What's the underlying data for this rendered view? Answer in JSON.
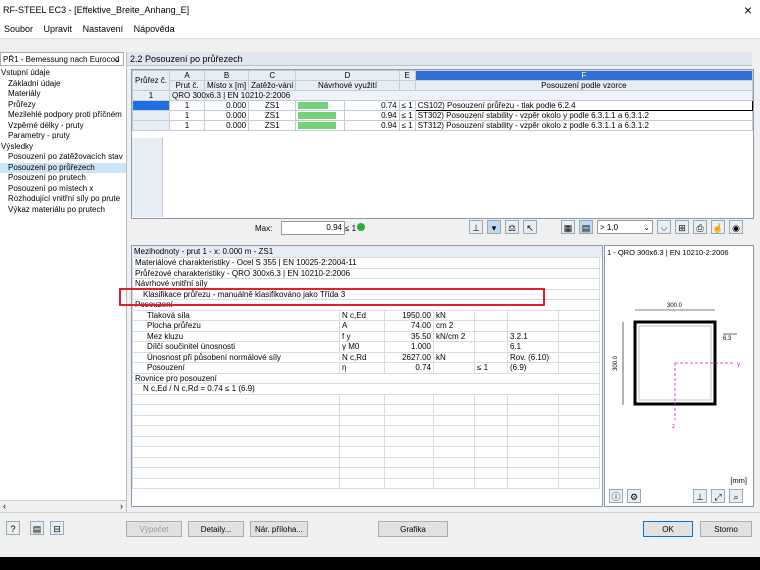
{
  "window": {
    "title": "RF-STEEL EC3 - [Effektive_Breite_Anhang_E]",
    "close": "×"
  },
  "menu": [
    "Soubor",
    "Upravit",
    "Nastavení",
    "Nápověda"
  ],
  "case_select": "PŘ1 - Bemessung nach Eurocod",
  "tree": [
    {
      "label": "Vstupní údaje",
      "indent": 0
    },
    {
      "label": "Základní údaje",
      "indent": 1
    },
    {
      "label": "Materiály",
      "indent": 1
    },
    {
      "label": "Průřezy",
      "indent": 1
    },
    {
      "label": "Mezilehlé podpory proti příčném",
      "indent": 1
    },
    {
      "label": "Vzpěrné délky - pruty",
      "indent": 1
    },
    {
      "label": "Parametry - pruty",
      "indent": 1
    },
    {
      "label": "Výsledky",
      "indent": 0
    },
    {
      "label": "Posouzení po zatěžovacích stav",
      "indent": 1
    },
    {
      "label": "Posouzení po průřezech",
      "indent": 1,
      "selected": true
    },
    {
      "label": "Posouzení po prutech",
      "indent": 1
    },
    {
      "label": "Posouzení po místech x",
      "indent": 1
    },
    {
      "label": "Rozhodující vnitřní síly po prute",
      "indent": 1
    },
    {
      "label": "Výkaz materiálu po prutech",
      "indent": 1
    }
  ],
  "panel_title": "2.2 Posouzení po průřezech",
  "grid": {
    "col_letters": [
      "A",
      "B",
      "C",
      "D",
      "E",
      "F"
    ],
    "headers": {
      "prurez": "Průřez č.",
      "prut": "Prut č.",
      "misto": "Místo x [m]",
      "zatez": "Zatěžo-vání",
      "navrh": "Návrhové využití",
      "vzorec": "Posouzení podle vzorce"
    },
    "section_row": {
      "no": "1",
      "label": "QRO 300x6.3 | EN 10210-2:2006"
    },
    "rows": [
      {
        "prut": "1",
        "x": "0.000",
        "lc": "ZS1",
        "util": "0.74",
        "le": "≤ 1",
        "formula": "CS102) Posouzení průřezu - tlak podle 6.2.4"
      },
      {
        "prut": "1",
        "x": "0.000",
        "lc": "ZS1",
        "util": "0.94",
        "le": "≤ 1",
        "formula": "ST302) Posouzení stability - vzpěr okolo y podle 6.3.1.1 a 6.3.1.2"
      },
      {
        "prut": "1",
        "x": "0.000",
        "lc": "ZS1",
        "util": "0.94",
        "le": "≤ 1",
        "formula": "ST312) Posouzení stability - vzpěr okolo z podle 6.3.1.1 a 6.3.1.2"
      }
    ],
    "util_fractions": [
      0.74,
      0.94,
      0.94
    ],
    "max_label": "Max:",
    "max_value": "0.94",
    "max_le": "≤ 1",
    "filter_value": "> 1,0"
  },
  "detail": {
    "header": "Mezihodnoty - prut 1 - x: 0.000 m - ZS1",
    "rows": [
      {
        "kind": "group",
        "label": "Materiálové charakteristiky - Ocel S 355 | EN 10025-2:2004-11"
      },
      {
        "kind": "group",
        "label": "Průřezové charakteristiky - QRO 300x6.3 | EN 10210-2:2006"
      },
      {
        "kind": "group",
        "label": "Návrhové vnitřní síly"
      },
      {
        "kind": "plain",
        "label": "Klasifikace průřezu - manuálně klasifikováno jako Třída 3"
      },
      {
        "kind": "group",
        "label": "Posouzení"
      },
      {
        "kind": "val",
        "label": "Tlaková síla",
        "sym": "N c,Ed",
        "val": "1950.00",
        "unit": "kN",
        "le": "",
        "ref": ""
      },
      {
        "kind": "val",
        "label": "Plocha průřezu",
        "sym": "A",
        "val": "74.00",
        "unit": "cm 2",
        "le": "",
        "ref": ""
      },
      {
        "kind": "val",
        "label": "Mez kluzu",
        "sym": "f y",
        "val": "35.50",
        "unit": "kN/cm 2",
        "le": "",
        "ref": "3.2.1"
      },
      {
        "kind": "val",
        "label": "Dílčí součinitel únosnosti",
        "sym": "γ M0",
        "val": "1.000",
        "unit": "",
        "le": "",
        "ref": "6.1"
      },
      {
        "kind": "val",
        "label": "Únosnost při působení normálové síly",
        "sym": "N c,Rd",
        "val": "2627.00",
        "unit": "kN",
        "le": "",
        "ref": "Rov. (6.10)"
      },
      {
        "kind": "val",
        "label": "Posouzení",
        "sym": "η",
        "val": "0.74",
        "unit": "",
        "le": "≤ 1",
        "ref": "(6.9)"
      },
      {
        "kind": "group",
        "label": "Rovnice pro posouzení"
      },
      {
        "kind": "plain",
        "label": "N c,Ed / N c,Rd = 0.74 ≤ 1   (6.9)"
      }
    ]
  },
  "xsection": {
    "title": "1 - QRO 300x6.3 | EN 10210-2:2006",
    "width_dim": "300.0",
    "height_dim": "300.0",
    "thick_dim": "6.3",
    "axis_y": "y",
    "axis_z": "z",
    "units": "[mm]"
  },
  "buttons": {
    "vypocet": "Výpočet",
    "detaily": "Detaily...",
    "nar_priloha": "Nár. příloha...",
    "grafika": "Grafika",
    "ok": "OK",
    "storno": "Storno"
  },
  "colors": {
    "accent": "#2f6fd6",
    "util_bar": "#76d27a",
    "highlight": "#e0202a"
  }
}
